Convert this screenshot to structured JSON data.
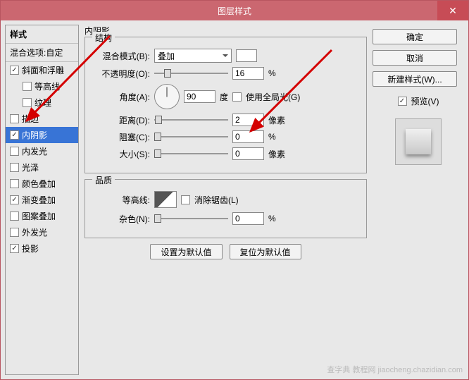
{
  "window": {
    "title": "图层样式"
  },
  "styles": {
    "header": "样式",
    "blend_opts": "混合选项:自定",
    "items": [
      {
        "label": "斜面和浮雕",
        "checked": true,
        "indent": false
      },
      {
        "label": "等高线",
        "checked": false,
        "indent": true
      },
      {
        "label": "纹理",
        "checked": false,
        "indent": true
      },
      {
        "label": "描边",
        "checked": false,
        "indent": false
      },
      {
        "label": "内阴影",
        "checked": true,
        "indent": false,
        "selected": true
      },
      {
        "label": "内发光",
        "checked": false,
        "indent": false
      },
      {
        "label": "光泽",
        "checked": false,
        "indent": false
      },
      {
        "label": "颜色叠加",
        "checked": false,
        "indent": false
      },
      {
        "label": "渐变叠加",
        "checked": true,
        "indent": false
      },
      {
        "label": "图案叠加",
        "checked": false,
        "indent": false
      },
      {
        "label": "外发光",
        "checked": false,
        "indent": false
      },
      {
        "label": "投影",
        "checked": true,
        "indent": false
      }
    ]
  },
  "panel": {
    "heading": "内阴影",
    "structure_legend": "结构",
    "blend_mode_label": "混合模式(B):",
    "blend_mode_value": "叠加",
    "opacity_label": "不透明度(O):",
    "opacity_value": "16",
    "opacity_unit": "%",
    "angle_label": "角度(A):",
    "angle_value": "90",
    "angle_unit": "度",
    "use_global": "使用全局光(G)",
    "distance_label": "距离(D):",
    "distance_value": "2",
    "distance_unit": "像素",
    "choke_label": "阻塞(C):",
    "choke_value": "0",
    "choke_unit": "%",
    "size_label": "大小(S):",
    "size_value": "0",
    "size_unit": "像素",
    "quality_legend": "品质",
    "contour_label": "等高线:",
    "antialias": "消除锯齿(L)",
    "noise_label": "杂色(N):",
    "noise_value": "0",
    "noise_unit": "%",
    "set_default": "设置为默认值",
    "reset_default": "复位为默认值"
  },
  "buttons": {
    "ok": "确定",
    "cancel": "取消",
    "new_style": "新建样式(W)...",
    "preview": "预览(V)"
  },
  "watermark": "查字典 教程网  jiaocheng.chazidian.com"
}
